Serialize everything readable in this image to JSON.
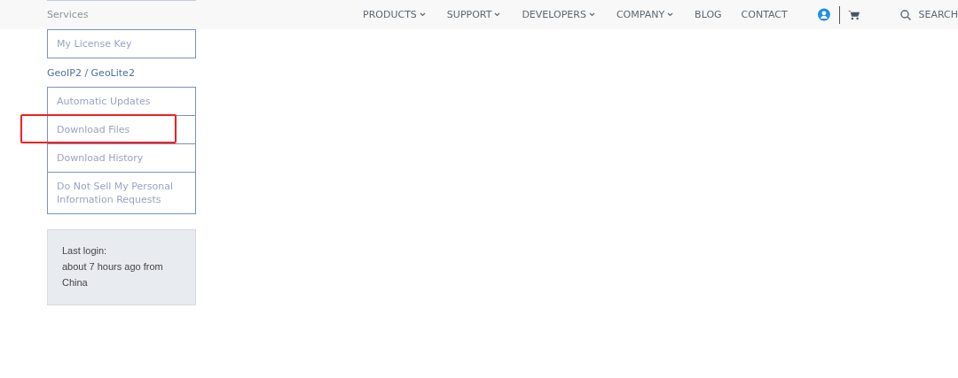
{
  "header": {
    "nav": [
      {
        "label": "PRODUCTS",
        "dropdown": true
      },
      {
        "label": "SUPPORT",
        "dropdown": true
      },
      {
        "label": "DEVELOPERS",
        "dropdown": true
      },
      {
        "label": "COMPANY",
        "dropdown": true
      },
      {
        "label": "BLOG",
        "dropdown": false
      },
      {
        "label": "CONTACT",
        "dropdown": false
      }
    ],
    "search": {
      "label": "SEARCH"
    }
  },
  "sidebar": {
    "groups": [
      {
        "heading": "Services",
        "items": [
          {
            "label": "My License Key",
            "highlighted": false
          }
        ]
      },
      {
        "heading": "GeoIP2 / GeoLite2",
        "items": [
          {
            "label": "Automatic Updates",
            "highlighted": false
          },
          {
            "label": "Download Files",
            "highlighted": true
          },
          {
            "label": "Download History",
            "highlighted": false
          },
          {
            "label": "Do Not Sell My Personal Information Requests",
            "highlighted": false
          }
        ]
      }
    ],
    "last_login": {
      "lines": [
        "Last login:",
        "about 7 hours ago from",
        "China"
      ]
    }
  }
}
